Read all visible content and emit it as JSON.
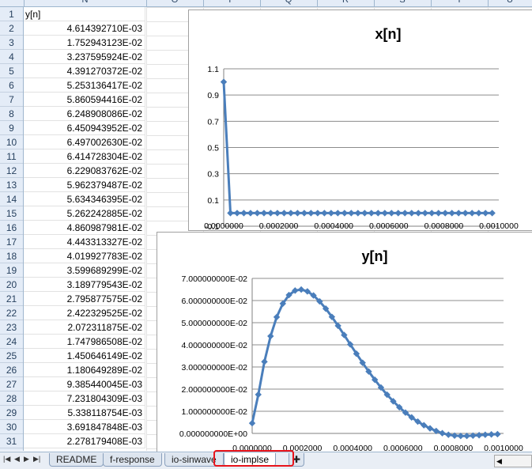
{
  "sheet": {
    "column_headers": [
      "N",
      "O",
      "P",
      "Q",
      "R",
      "S",
      "T",
      "U"
    ],
    "row_numbers": [
      "1",
      "2",
      "3",
      "4",
      "5",
      "6",
      "7",
      "8",
      "9",
      "10",
      "11",
      "12",
      "13",
      "14",
      "15",
      "16",
      "17",
      "18",
      "19",
      "20",
      "21",
      "22",
      "23",
      "24",
      "25",
      "26",
      "27",
      "28",
      "29",
      "30",
      "31"
    ],
    "columnN": [
      "y[n]",
      "4.614392710E-03",
      "1.752943123E-02",
      "3.237595924E-02",
      "4.391270372E-02",
      "5.253136417E-02",
      "5.860594416E-02",
      "6.248908086E-02",
      "6.450943952E-02",
      "6.497002630E-02",
      "6.414728304E-02",
      "6.229083762E-02",
      "5.962379487E-02",
      "5.634346395E-02",
      "5.262242885E-02",
      "4.860987981E-02",
      "4.443313327E-02",
      "4.019927783E-02",
      "3.599689299E-02",
      "3.189779543E-02",
      "2.795877575E-02",
      "2.422329525E-02",
      "2.072311875E-02",
      "1.747986508E-02",
      "1.450646149E-02",
      "1.180649289E-02",
      "9.385440045E-03",
      "7.231804309E-03",
      "5.338118754E-03",
      "3.691847848E-03",
      "2.278179408E-03"
    ]
  },
  "chart_data": [
    {
      "type": "line",
      "title": "x[n]",
      "xlabel": "",
      "ylabel": "",
      "x_ticks": [
        "0.0000000",
        "0.0002000",
        "0.0004000",
        "0.0006000",
        "0.0008000",
        "0.0010000"
      ],
      "y_ticks": [
        "-0.1",
        "0.1",
        "0.3",
        "0.5",
        "0.7",
        "0.9",
        "1.1"
      ],
      "xlim": [
        0,
        0.001
      ],
      "ylim": [
        -0.1,
        1.1
      ],
      "x": [
        0.0,
        2.44e-05,
        4.88e-05,
        7.32e-05,
        9.76e-05,
        0.000122,
        0.0001464,
        0.0001708,
        0.0001952,
        0.0002196,
        0.000244,
        0.0002684,
        0.0002928,
        0.0003172,
        0.0003416,
        0.000366,
        0.0003904,
        0.0004148,
        0.0004392,
        0.0004636,
        0.000488,
        0.0005124,
        0.0005368,
        0.0005612,
        0.0005856,
        0.00061,
        0.0006344,
        0.0006588,
        0.0006832,
        0.0007076,
        0.000732,
        0.0007564,
        0.0007808,
        0.0008052,
        0.0008296,
        0.000854,
        0.0008784,
        0.0009028,
        0.0009272,
        0.0009516,
        0.000976
      ],
      "values": [
        1,
        0,
        0,
        0,
        0,
        0,
        0,
        0,
        0,
        0,
        0,
        0,
        0,
        0,
        0,
        0,
        0,
        0,
        0,
        0,
        0,
        0,
        0,
        0,
        0,
        0,
        0,
        0,
        0,
        0,
        0,
        0,
        0,
        0,
        0,
        0,
        0,
        0,
        0,
        0,
        0
      ],
      "grid": true,
      "color": "#4a7ebb"
    },
    {
      "type": "line",
      "title": "y[n]",
      "xlabel": "",
      "ylabel": "",
      "x_ticks": [
        "0.0000000",
        "0.0002000",
        "0.0004000",
        "0.0006000",
        "0.0008000",
        "0.0010000"
      ],
      "y_ticks": [
        "0.000000000E+00",
        "1.000000000E-02",
        "2.000000000E-02",
        "3.000000000E-02",
        "4.000000000E-02",
        "5.000000000E-02",
        "6.000000000E-02",
        "7.000000000E-02"
      ],
      "xlim": [
        0,
        0.001
      ],
      "ylim": [
        0,
        0.07
      ],
      "x": [
        0.0,
        2.44e-05,
        4.88e-05,
        7.32e-05,
        9.76e-05,
        0.000122,
        0.0001464,
        0.0001708,
        0.0001952,
        0.0002196,
        0.000244,
        0.0002684,
        0.0002928,
        0.0003172,
        0.0003416,
        0.000366,
        0.0003904,
        0.0004148,
        0.0004392,
        0.0004636,
        0.000488,
        0.0005124,
        0.0005368,
        0.0005612,
        0.0005856,
        0.00061,
        0.0006344,
        0.0006588,
        0.0006832,
        0.0007076,
        0.000732,
        0.0007564,
        0.0007808,
        0.0008052,
        0.0008296,
        0.000854,
        0.0008784,
        0.0009028,
        0.0009272,
        0.0009516,
        0.000976
      ],
      "values": [
        0.004614,
        0.017529,
        0.032376,
        0.043913,
        0.052531,
        0.058606,
        0.062489,
        0.064509,
        0.06497,
        0.064147,
        0.062291,
        0.059624,
        0.056343,
        0.052622,
        0.04861,
        0.044433,
        0.040199,
        0.035997,
        0.031898,
        0.027959,
        0.024223,
        0.020723,
        0.01748,
        0.014506,
        0.011806,
        0.009385,
        0.007232,
        0.005338,
        0.003692,
        0.002278,
        0.0011,
        0.0001,
        -0.0006,
        -0.001,
        -0.00115,
        -0.00115,
        -0.001,
        -0.0008,
        -0.0006,
        -0.00045,
        -0.00035
      ],
      "grid": true,
      "color": "#4a7ebb"
    }
  ],
  "tabs": {
    "nav_glyphs": [
      "|◀",
      "◀",
      "▶",
      "▶|"
    ],
    "items": [
      "README",
      "f-response",
      "io-sinwave",
      "io-implse"
    ],
    "active": "io-implse"
  }
}
